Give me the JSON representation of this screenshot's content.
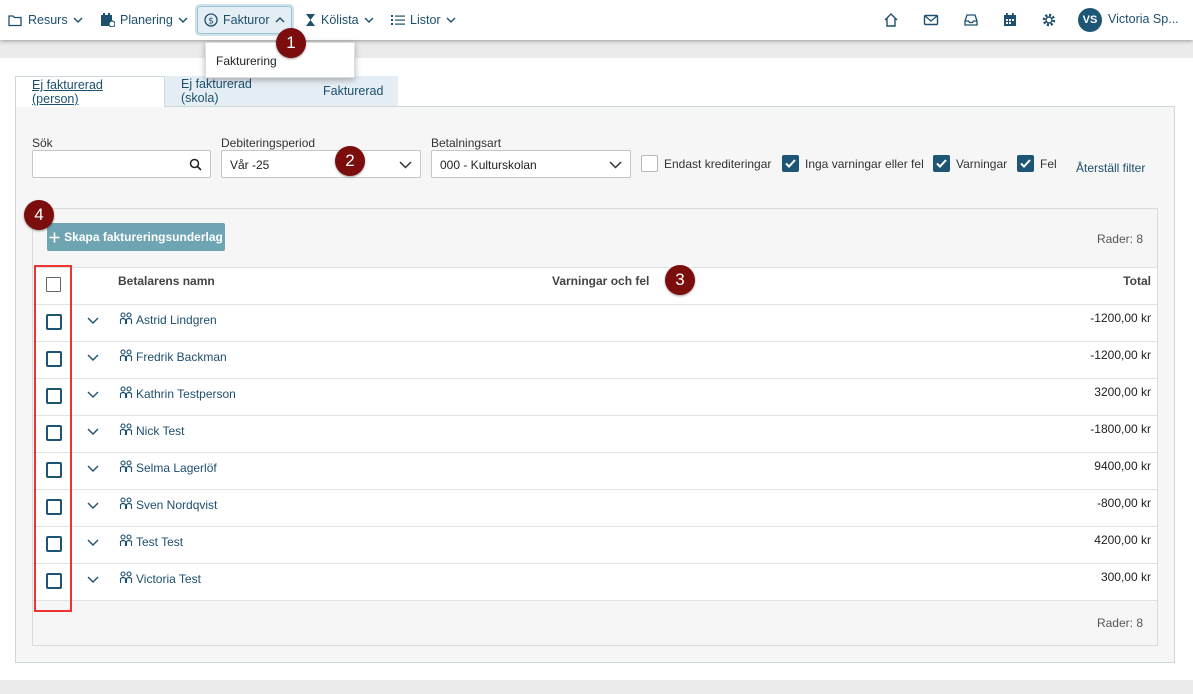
{
  "nav": {
    "items": [
      {
        "label": "Resurs",
        "icon": "folder-icon"
      },
      {
        "label": "Planering",
        "icon": "calendar-icon"
      },
      {
        "label": "Fakturor",
        "icon": "dollar-circle-icon",
        "active": true
      },
      {
        "label": "Kölista",
        "icon": "hourglass-icon"
      },
      {
        "label": "Listor",
        "icon": "list-icon"
      }
    ],
    "right_icons": [
      "home-icon",
      "mail-icon",
      "inbox-icon",
      "calendar-grid-icon",
      "gear-icon"
    ],
    "avatar_initials": "VS",
    "user_name": "Victoria Sp..."
  },
  "dropdown": {
    "item": "Fakturering"
  },
  "badges": [
    "1",
    "2",
    "3",
    "4"
  ],
  "tabs": [
    "Ej fakturerad (person)",
    "Ej fakturerad (skola)",
    "Fakturerad"
  ],
  "filters": {
    "search_label": "Sök",
    "search_value": "",
    "period_label": "Debiteringsperiod",
    "period_value": "Vår -25",
    "payment_label": "Betalningsart",
    "payment_value": "000 - Kulturskolan",
    "checkboxes": [
      {
        "label": "Endast krediteringar",
        "checked": false
      },
      {
        "label": "Inga varningar eller fel",
        "checked": true
      },
      {
        "label": "Varningar",
        "checked": true
      },
      {
        "label": "Fel",
        "checked": true
      }
    ],
    "reset_label": "Återställ filter"
  },
  "grid": {
    "create_button": "Skapa faktureringsunderlag",
    "rows_label_top": "Rader: 8",
    "rows_label_bottom": "Rader: 8",
    "columns": [
      "Betalarens namn",
      "Varningar och fel",
      "Total"
    ],
    "rows": [
      {
        "name": "Astrid Lindgren",
        "total": "-1200,00 kr"
      },
      {
        "name": "Fredrik Backman",
        "total": "-1200,00 kr"
      },
      {
        "name": "Kathrin Testperson",
        "total": "3200,00 kr"
      },
      {
        "name": "Nick Test",
        "total": "-1800,00 kr"
      },
      {
        "name": "Selma Lagerlöf",
        "total": "9400,00 kr"
      },
      {
        "name": "Sven Nordqvist",
        "total": "-800,00 kr"
      },
      {
        "name": "Test Test",
        "total": "4200,00 kr"
      },
      {
        "name": "Victoria Test",
        "total": "300,00 kr"
      }
    ]
  },
  "colors": {
    "primary": "#1d5675",
    "badge": "#7b0d0d",
    "highlight": "#e33333",
    "button": "#6fa4b3"
  }
}
